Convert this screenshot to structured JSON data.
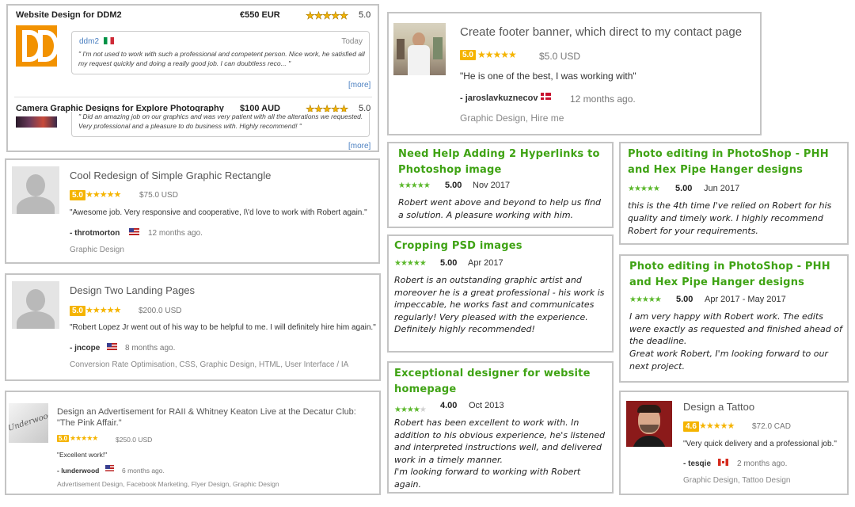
{
  "card1": {
    "title": "Website Design for DDM2",
    "price": "€550 EUR",
    "rating": "5.0",
    "stars": "★★★★★",
    "user": "ddm2",
    "date": "Today",
    "quote": "\" I'm not used to work with such a professional and competent person. Nice work, he satisfied all my request quickly and doing a really good job. I can doubtless reco... \"",
    "more": "[more]",
    "title2": "Camera Graphic Designs for Explore Photography",
    "price2": "$100 AUD",
    "rating2": "5.0",
    "quote2": "\" Did an amazing job on our graphics and was very patient with all the alterations we requested. Very professional and a pleasure to do business with. Highly recommend! \"",
    "more2": "[more]"
  },
  "card2": {
    "title": "Create footer banner, which direct to my contact page",
    "rating": "5.0",
    "stars": "★★★★★",
    "price": "$5.0 USD",
    "quote": "\"He is one of the best, I was working with\"",
    "user": "- jaroslavkuznecov",
    "time": "12 months ago.",
    "tags": "Graphic Design, Hire me"
  },
  "card3": {
    "title": "Cool Redesign of Simple Graphic Rectangle",
    "rating": "5.0",
    "stars": "★★★★★",
    "price": "$75.0 USD",
    "quote": "\"Awesome job. Very responsive and cooperative, I\\'d love to work with Robert again.\"",
    "user": "- throtmorton",
    "time": "12 months ago.",
    "tags": "Graphic Design"
  },
  "card4": {
    "title": "Design Two Landing Pages",
    "rating": "5.0",
    "stars": "★★★★★",
    "price": "$200.0 USD",
    "quote": "\"Robert Lopez Jr went out of his way to be helpful to me. I will definitely hire him again.\"",
    "user": "- jncope",
    "time": "8 months ago.",
    "tags": "Conversion Rate Optimisation, CSS, Graphic Design, HTML, User Interface / IA"
  },
  "card5": {
    "title": "Design an Advertisement for RAII & Whitney Keaton Live at the Decatur Club: \"The Pink Affair.\"",
    "rating": "5.0",
    "stars": "★★★★★",
    "price": "$250.0 USD",
    "quote": "\"Excellent work!\"",
    "user": "- lunderwood",
    "time": "6 months ago.",
    "tags": "Advertisement Design, Facebook Marketing, Flyer Design, Graphic Design",
    "logo_text": "Underwood"
  },
  "g1": {
    "title": "Need Help Adding 2 Hyperlinks to Photoshop image",
    "stars": "★★★★★",
    "score": "5.00",
    "date": "Nov 2017",
    "text": "Robert went above and beyond to help us find a solution. A pleasure working with him."
  },
  "g2": {
    "title": "Cropping PSD images",
    "stars": "★★★★★",
    "score": "5.00",
    "date": "Apr 2017",
    "text": "Robert is an outstanding graphic artist and moreover he is a great professional - his work is impeccable, he works fast and communicates regularly! Very pleased with the experience. Definitely highly recommended!"
  },
  "g3": {
    "title": "Exceptional designer for website homepage",
    "stars": "★★★★",
    "stars_empty": "★",
    "score": "4.00",
    "date": "Oct 2013",
    "text": "Robert has been excellent to work with. In addition to his obvious experience, he's listened and interpreted instructions well, and delivered work in a timely manner.",
    "text2": "I'm looking forward to working with Robert again."
  },
  "g4": {
    "title": "Photo editing in PhotoShop - PHH and Hex Pipe Hanger designs",
    "stars": "★★★★★",
    "score": "5.00",
    "date": "Jun 2017",
    "text": "this is the 4th time I've relied on Robert for his quality and timely work. I highly recommend Robert for your requirements."
  },
  "g5": {
    "title": "Photo editing in PhotoShop - PHH and Hex Pipe Hanger designs",
    "stars": "★★★★★",
    "score": "5.00",
    "date": "Apr 2017 - May 2017",
    "text": "I am very happy with Robert work. The edits were exactly as requested and finished ahead of the deadline.",
    "text2": "Great work Robert, I'm looking forward to our next project."
  },
  "card6": {
    "title": "Design a Tattoo",
    "rating": "4.6",
    "stars": "★★★★★",
    "price": "$72.0 CAD",
    "quote": "\"Very quick delivery and a professional job.\"",
    "user": "- tesqie",
    "time": "2 months ago.",
    "tags": "Graphic Design, Tattoo Design"
  }
}
